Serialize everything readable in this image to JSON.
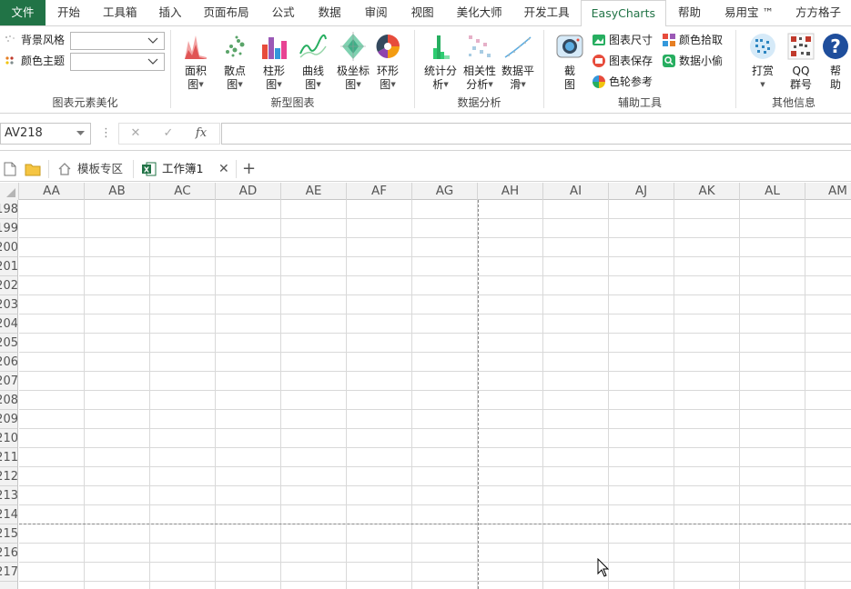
{
  "tabs": [
    "文件",
    "开始",
    "工具箱",
    "插入",
    "页面布局",
    "公式",
    "数据",
    "审阅",
    "视图",
    "美化大师",
    "开发工具",
    "EasyCharts",
    "帮助",
    "易用宝 ™",
    "方方格子"
  ],
  "active_tab": "EasyCharts",
  "ribbon": {
    "beautify": {
      "bg_style": "背景风格",
      "color_theme": "颜色主题",
      "label": "图表元素美化"
    },
    "new_charts": {
      "label": "新型图表",
      "buttons": [
        {
          "l1": "面积",
          "l2": "图"
        },
        {
          "l1": "散点",
          "l2": "图"
        },
        {
          "l1": "柱形",
          "l2": "图"
        },
        {
          "l1": "曲线",
          "l2": "图"
        },
        {
          "l1": "极坐标",
          "l2": "图"
        },
        {
          "l1": "环形",
          "l2": "图"
        }
      ]
    },
    "analysis": {
      "label": "数据分析",
      "buttons": [
        {
          "l1": "统计分",
          "l2": "析"
        },
        {
          "l1": "相关性",
          "l2": "分析"
        },
        {
          "l1": "数据平",
          "l2": "滑"
        }
      ]
    },
    "tools": {
      "label": "辅助工具",
      "screenshot_l1": "截",
      "screenshot_l2": "图",
      "chart_size": "图表尺寸",
      "chart_save": "图表保存",
      "color_wheel": "色轮参考",
      "color_pick": "颜色拾取",
      "data_thief": "数据小偷"
    },
    "info": {
      "label": "其他信息",
      "reward": "打赏",
      "qq_l1": "QQ",
      "qq_l2": "群号",
      "help_l1": "帮",
      "help_l2": "助"
    }
  },
  "formula_bar": {
    "name_box": "AV218",
    "cancel": "✕",
    "confirm": "✓",
    "fx": "fx",
    "formula": ""
  },
  "workbook_tabs": {
    "template_zone": "模板专区",
    "sheet": "工作簿1",
    "close": "✕",
    "add": "+"
  },
  "columns": [
    "AA",
    "AB",
    "AC",
    "AD",
    "AE",
    "AF",
    "AG",
    "AH",
    "AI",
    "AJ",
    "AK",
    "AL",
    "AM"
  ],
  "rows": [
    "198",
    "199",
    "200",
    "201",
    "202",
    "203",
    "204",
    "205",
    "206",
    "207",
    "208",
    "209",
    "210",
    "211",
    "212",
    "213",
    "214",
    "215",
    "216",
    "217"
  ],
  "colors": {
    "accent": "#217346"
  }
}
